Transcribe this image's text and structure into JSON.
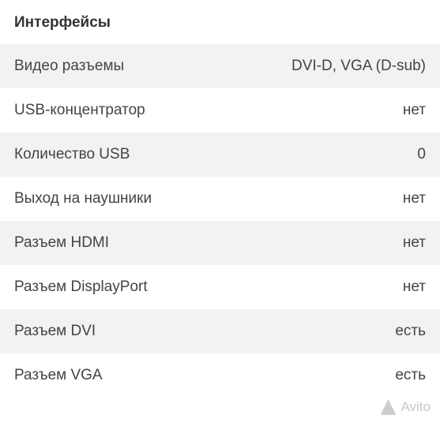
{
  "section_title": "Интерфейсы",
  "rows": [
    {
      "label": "Видео разъемы",
      "value": "DVI-D, VGA (D-sub)"
    },
    {
      "label": "USB-концентратор",
      "value": "нет"
    },
    {
      "label": "Количество USB",
      "value": "0"
    },
    {
      "label": "Выход на наушники",
      "value": "нет"
    },
    {
      "label": "Разъем HDMI",
      "value": "нет"
    },
    {
      "label": "Разъем DisplayPort",
      "value": "нет"
    },
    {
      "label": "Разъем DVI",
      "value": "есть"
    },
    {
      "label": "Разъем VGA",
      "value": "есть"
    }
  ],
  "watermark": "Avito"
}
